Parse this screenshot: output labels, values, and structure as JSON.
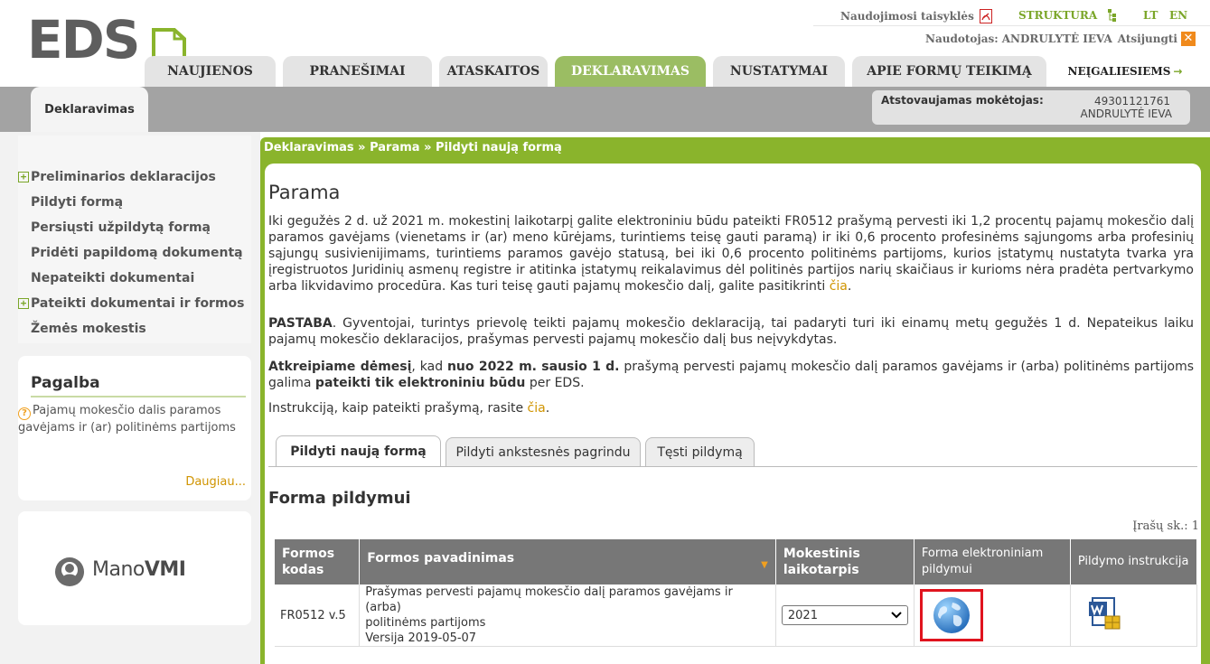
{
  "header": {
    "logo_text": "EDS",
    "rules_label": "Naudojimosi taisyklės",
    "struktura_label": "STRUKTURA",
    "lang_lt": "LT",
    "lang_en": "EN",
    "user_prefix": "Naudotojas:",
    "user_name": "ANDRULYTĖ IEVA",
    "logout_label": "Atsijungti"
  },
  "main_tabs": [
    {
      "label": "NAUJIENOS",
      "active": false
    },
    {
      "label": "PRANEŠIMAI",
      "active": false
    },
    {
      "label": "ATASKAITOS",
      "active": false
    },
    {
      "label": "DEKLARAVIMAS",
      "active": true
    },
    {
      "label": "NUSTATYMAI",
      "active": false
    },
    {
      "label": "APIE FORMŲ TEIKIMĄ",
      "active": false
    }
  ],
  "accessible_link": "NEĮGALIESIEMS",
  "subbar": {
    "active_subtab": "Deklaravimas",
    "payer_label": "Atstovaujamas mokėtojas:",
    "payer_id": "49301121761",
    "payer_name": "ANDRULYTĖ IEVA"
  },
  "sidebar": {
    "items": [
      {
        "label": "Preliminarios deklaracijos",
        "expandable": true
      },
      {
        "label": "Pildyti formą",
        "expandable": false
      },
      {
        "label": "Persiųsti užpildytą formą",
        "expandable": false
      },
      {
        "label": "Pridėti papildomą dokumentą",
        "expandable": false
      },
      {
        "label": "Nepateikti dokumentai",
        "expandable": false
      },
      {
        "label": "Pateikti dokumentai ir formos",
        "expandable": true
      },
      {
        "label": "Žemės mokestis",
        "expandable": false
      }
    ],
    "help_title": "Pagalba",
    "help_text": "Pajamų mokesčio dalis paramos gavėjams ir (ar) politinėms partijoms",
    "help_more": "Daugiau...",
    "manovmi_prefix": "Mano",
    "manovmi_suffix": "VMI"
  },
  "breadcrumb": "Deklaravimas » Parama » Pildyti naują formą",
  "content": {
    "title": "Parama",
    "p1": "Iki gegužės 2 d. už 2021 m. mokestinį laikotarpį galite elektroniniu būdu pateikti FR0512 prašymą pervesti iki 1,2 procentų pajamų mokesčio dalį paramos gavėjams (vienetams ir (ar) meno kūrėjams, turintiems teisę gauti paramą) ir iki 0,6 procento profesinėms sąjungoms arba profesinių sąjungų susivienijimams, turintiems paramos gavėjo statusą, bei iki 0,6 procento politinėms partijoms, kurios įstatymų nustatyta tvarka yra įregistruotos Juridinių asmenų registre ir atitinka įstatymų reikalavimus dėl politinės partijos narių skaičiaus ir kurioms nėra pradėta pertvarkymo arba likvidavimo procedūra. Kas turi teisę gauti pajamų mokesčio dalį, galite pasitikrinti",
    "p1_link": "čia",
    "p2_bold": "PASTABA",
    "p2": ". Gyventojai, turintys prievolę teikti pajamų mokesčio deklaraciją, tai padaryti turi iki einamų metų gegužės 1 d. Nepateikus laiku pajamų mokesčio deklaracijos, prašymas pervesti pajamų mokesčio dalį bus neįvykdytas.",
    "p3_b1": "Atkreipiame dėmesį",
    "p3_t1": ", kad ",
    "p3_b2": "nuo 2022 m. sausio 1 d.",
    "p3_t2": " prašymą pervesti pajamų mokesčio dalį paramos gavėjams ir (arba) politinėms partijoms galima ",
    "p3_b3": "pateikti tik elektroniniu būdu",
    "p3_t3": " per EDS.",
    "p4": "Instrukciją, kaip pateikti prašymą, rasite",
    "p4_link": "čia",
    "form_tabs": [
      "Pildyti naują formą",
      "Pildyti ankstesnės pagrindu",
      "Tęsti pildymą"
    ],
    "section_title": "Forma pildymui",
    "record_count": "Įrašų sk.: 1"
  },
  "table": {
    "headers": [
      "Formos kodas",
      "Formos pavadinimas",
      "Mokestinis laikotarpis",
      "Forma elektroniniam pildymui",
      "Pildymo instrukcija"
    ],
    "rows": [
      {
        "code": "FR0512 v.5",
        "name_line1": "Prašymas pervesti pajamų mokesčio dalį paramos gavėjams ir (arba)",
        "name_line2": "politinėms partijoms",
        "version": "Versija 2019-05-07",
        "period": "2021"
      }
    ]
  },
  "colors": {
    "accent_green": "#8ab42c",
    "tab_active": "#9bbd63",
    "link_orange": "#d09400",
    "highlight_red": "#e0141e"
  }
}
